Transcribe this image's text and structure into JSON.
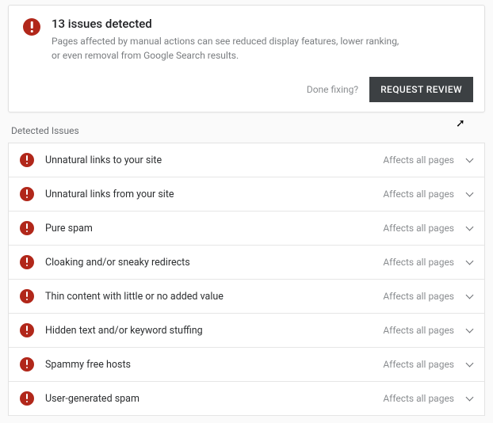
{
  "header": {
    "title": "13 issues detected",
    "description": "Pages affected by manual actions can see reduced display features, lower ranking, or even removal from Google Search results.",
    "done_fixing_label": "Done fixing?",
    "request_review_label": "REQUEST REVIEW"
  },
  "section_label": "Detected Issues",
  "affects_label": "Affects all pages",
  "issues": [
    {
      "title": "Unnatural links to your site"
    },
    {
      "title": "Unnatural links from your site"
    },
    {
      "title": "Pure spam"
    },
    {
      "title": "Cloaking and/or sneaky redirects"
    },
    {
      "title": "Thin content with little or no added value"
    },
    {
      "title": "Hidden text and/or keyword stuffing"
    },
    {
      "title": "Spammy free hosts"
    },
    {
      "title": "User-generated spam"
    }
  ]
}
